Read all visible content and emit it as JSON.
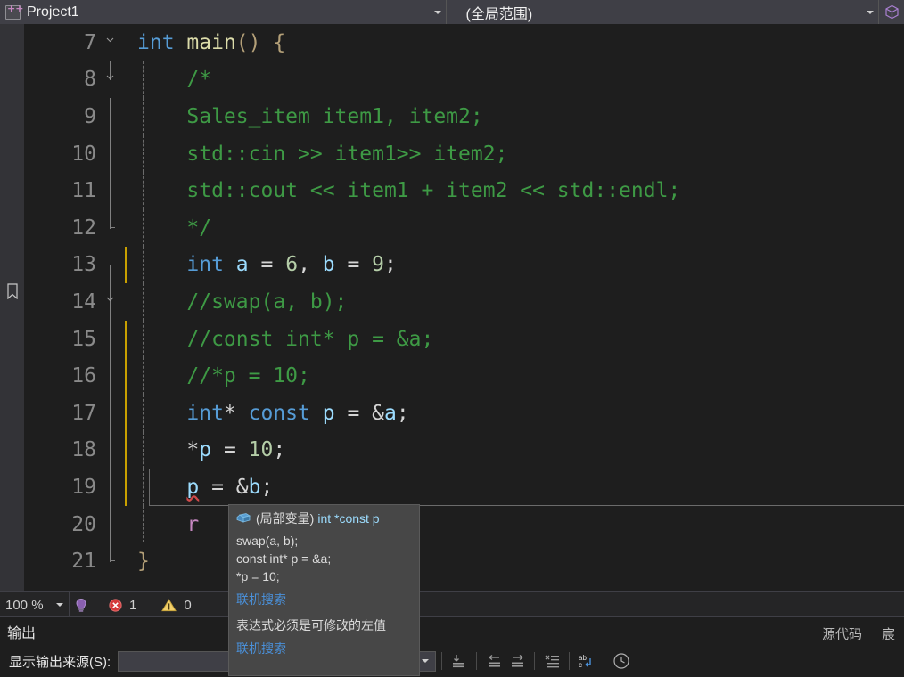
{
  "navbar": {
    "project_label": "Project1",
    "scope_label": "(全局范围)",
    "project_icon": "cpp-project-icon",
    "cube_icon": "cube-icon"
  },
  "editor": {
    "lines": [
      {
        "num": "7",
        "segments": [
          {
            "t": "int",
            "c": "kw"
          },
          {
            "t": " ",
            "c": "punct"
          },
          {
            "t": "main",
            "c": "fn"
          },
          {
            "t": "()",
            "c": "brace"
          },
          {
            "t": " ",
            "c": "punct"
          },
          {
            "t": "{",
            "c": "brace"
          }
        ]
      },
      {
        "num": "8",
        "segments": [
          {
            "t": "    /*",
            "c": "cmt"
          }
        ]
      },
      {
        "num": "9",
        "segments": [
          {
            "t": "    Sales_item item1, item2;",
            "c": "cmt"
          }
        ]
      },
      {
        "num": "10",
        "segments": [
          {
            "t": "    std::cin >> item1>> item2;",
            "c": "cmt"
          }
        ]
      },
      {
        "num": "11",
        "segments": [
          {
            "t": "    std::cout << item1 + item2 << std::endl;",
            "c": "cmt"
          }
        ]
      },
      {
        "num": "12",
        "segments": [
          {
            "t": "    */",
            "c": "cmt"
          }
        ]
      },
      {
        "num": "13",
        "segments": [
          {
            "t": "    ",
            "c": "punct"
          },
          {
            "t": "int",
            "c": "kw"
          },
          {
            "t": " ",
            "c": "punct"
          },
          {
            "t": "a",
            "c": "var"
          },
          {
            "t": " = ",
            "c": "punct"
          },
          {
            "t": "6",
            "c": "num"
          },
          {
            "t": ", ",
            "c": "punct"
          },
          {
            "t": "b",
            "c": "var"
          },
          {
            "t": " = ",
            "c": "punct"
          },
          {
            "t": "9",
            "c": "num"
          },
          {
            "t": ";",
            "c": "punct"
          }
        ]
      },
      {
        "num": "14",
        "segments": [
          {
            "t": "    //swap(a, b);",
            "c": "cmt"
          }
        ]
      },
      {
        "num": "15",
        "segments": [
          {
            "t": "    //const int* p = &a;",
            "c": "cmt"
          }
        ]
      },
      {
        "num": "16",
        "segments": [
          {
            "t": "    //*p = 10;",
            "c": "cmt"
          }
        ]
      },
      {
        "num": "17",
        "segments": [
          {
            "t": "    ",
            "c": "punct"
          },
          {
            "t": "int",
            "c": "kw"
          },
          {
            "t": "*",
            "c": "punct"
          },
          {
            "t": " ",
            "c": "punct"
          },
          {
            "t": "const",
            "c": "kw"
          },
          {
            "t": " ",
            "c": "punct"
          },
          {
            "t": "p",
            "c": "var"
          },
          {
            "t": " = &",
            "c": "punct"
          },
          {
            "t": "a",
            "c": "var"
          },
          {
            "t": ";",
            "c": "punct"
          }
        ]
      },
      {
        "num": "18",
        "segments": [
          {
            "t": "    *",
            "c": "punct"
          },
          {
            "t": "p",
            "c": "var"
          },
          {
            "t": " = ",
            "c": "punct"
          },
          {
            "t": "10",
            "c": "num"
          },
          {
            "t": ";",
            "c": "punct"
          }
        ]
      },
      {
        "num": "19",
        "segments": [
          {
            "t": "    ",
            "c": "punct"
          },
          {
            "t": "p",
            "c": "var sq"
          },
          {
            "t": " = &",
            "c": "punct"
          },
          {
            "t": "b",
            "c": "var"
          },
          {
            "t": ";",
            "c": "punct"
          }
        ]
      },
      {
        "num": "20",
        "segments": [
          {
            "t": "    r",
            "c": "macro"
          }
        ]
      },
      {
        "num": "21",
        "segments": [
          {
            "t": "}",
            "c": "brace"
          }
        ]
      }
    ],
    "bookmark_icon": "bookmark-icon"
  },
  "status": {
    "zoom": "100 %",
    "lightbulb_icon": "lightbulb-icon",
    "error_icon": "error-icon",
    "error_count": "1",
    "warning_icon": "warning-icon",
    "warning_count": "0"
  },
  "output": {
    "title": "输出",
    "source_label": "显示输出来源(S):",
    "source_value": "",
    "toolbar_icons": [
      "go-to-source-icon",
      "navigate-back-icon",
      "navigate-forward-icon",
      "clear-all-icon",
      "word-wrap-icon",
      "history-icon"
    ],
    "right_items": [
      "源代码",
      "宸"
    ]
  },
  "tooltip": {
    "icon": "variable-box-icon",
    "scope": "(局部变量)",
    "type": "int *const p",
    "body_lines": [
      "swap(a, b);",
      "const int* p = &a;",
      "*p = 10;"
    ],
    "link_1": "联机搜索",
    "error_message": "表达式必须是可修改的左值",
    "link_2": "联机搜索"
  }
}
